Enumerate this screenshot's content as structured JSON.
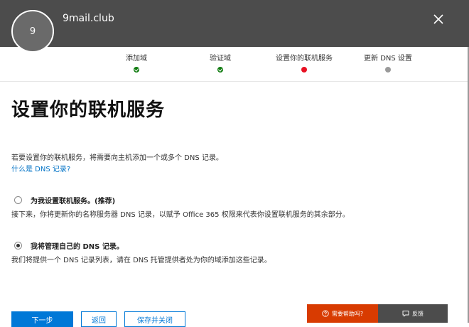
{
  "header": {
    "avatar_initial": "9",
    "domain": "9mail.club"
  },
  "steps": [
    {
      "label": "添加域",
      "status": "done"
    },
    {
      "label": "验证域",
      "status": "done"
    },
    {
      "label": "设置你的联机服务",
      "status": "current"
    },
    {
      "label": "更新 DNS 设置",
      "status": "pending"
    }
  ],
  "main": {
    "title": "设置你的联机服务",
    "intro": "若要设置你的联机服务，将需要向主机添加一个或多个 DNS 记录。",
    "help_link": "什么是 DNS 记录?",
    "options": [
      {
        "label": "为我设置联机服务。(推荐)",
        "description": "接下来，你将更新你的名称服务器 DNS 记录，以赋予 Office 365 权限来代表你设置联机服务的其余部分。",
        "selected": false
      },
      {
        "label": "我将管理自己的 DNS 记录。",
        "description": "我们将提供一个 DNS 记录列表，请在 DNS 托管提供者处为你的域添加这些记录。",
        "selected": true
      }
    ]
  },
  "buttons": {
    "next": "下一步",
    "back": "返回",
    "save_close": "保存并关闭"
  },
  "footer": {
    "need_help": "需要帮助吗?",
    "feedback": "反馈"
  },
  "colors": {
    "header_bg": "#4c4c4c",
    "accent": "#0078d7",
    "link": "#0072c6",
    "step_done": "#107c10",
    "step_current": "#e81123",
    "step_pending": "#9a9a9a",
    "help_bar": "#d83b01"
  }
}
